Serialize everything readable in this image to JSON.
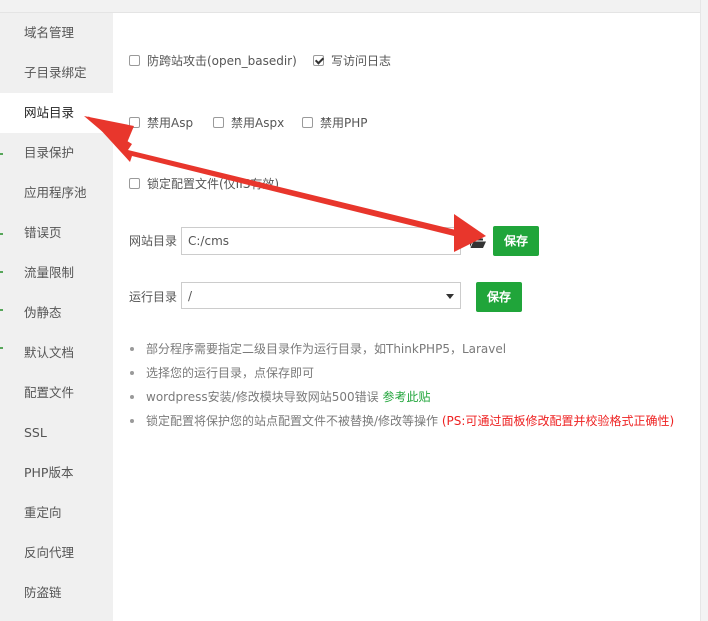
{
  "sidebar": {
    "items": [
      {
        "label": "域名管理",
        "active": false
      },
      {
        "label": "子目录绑定",
        "active": false
      },
      {
        "label": "网站目录",
        "active": true
      },
      {
        "label": "目录保护",
        "active": false
      },
      {
        "label": "应用程序池",
        "active": false
      },
      {
        "label": "错误页",
        "active": false
      },
      {
        "label": "流量限制",
        "active": false
      },
      {
        "label": "伪静态",
        "active": false
      },
      {
        "label": "默认文档",
        "active": false
      },
      {
        "label": "配置文件",
        "active": false
      },
      {
        "label": "SSL",
        "active": false
      },
      {
        "label": "PHP版本",
        "active": false
      },
      {
        "label": "重定向",
        "active": false
      },
      {
        "label": "反向代理",
        "active": false
      },
      {
        "label": "防盗链",
        "active": false
      }
    ]
  },
  "options": {
    "open_basedir": {
      "label": "防跨站攻击(open_basedir)",
      "checked": false
    },
    "access_log": {
      "label": "写访问日志",
      "checked": true
    },
    "disable_asp": {
      "label": "禁用Asp",
      "checked": false
    },
    "disable_aspx": {
      "label": "禁用Aspx",
      "checked": false
    },
    "disable_php": {
      "label": "禁用PHP",
      "checked": false
    },
    "lock_config": {
      "label": "锁定配置文件(仅IIS有效)",
      "checked": false
    }
  },
  "site_dir": {
    "label": "网站目录",
    "value": "C:/cms",
    "save_label": "保存"
  },
  "run_dir": {
    "label": "运行目录",
    "value": "/",
    "save_label": "保存"
  },
  "tips": {
    "t1": "部分程序需要指定二级目录作为运行目录，如ThinkPHP5，Laravel",
    "t2": "选择您的运行目录，点保存即可",
    "t3": "wordpress安装/修改模块导致网站500错误",
    "t3_link": "参考此贴",
    "t4": "锁定配置将保护您的站点配置文件不被替换/修改等操作",
    "t4_red": "(PS:可通过面板修改配置并校验格式正确性)"
  },
  "colors": {
    "primary": "#20a53a",
    "annotation_red": "#e8362c",
    "warning_red": "#ee2222"
  }
}
